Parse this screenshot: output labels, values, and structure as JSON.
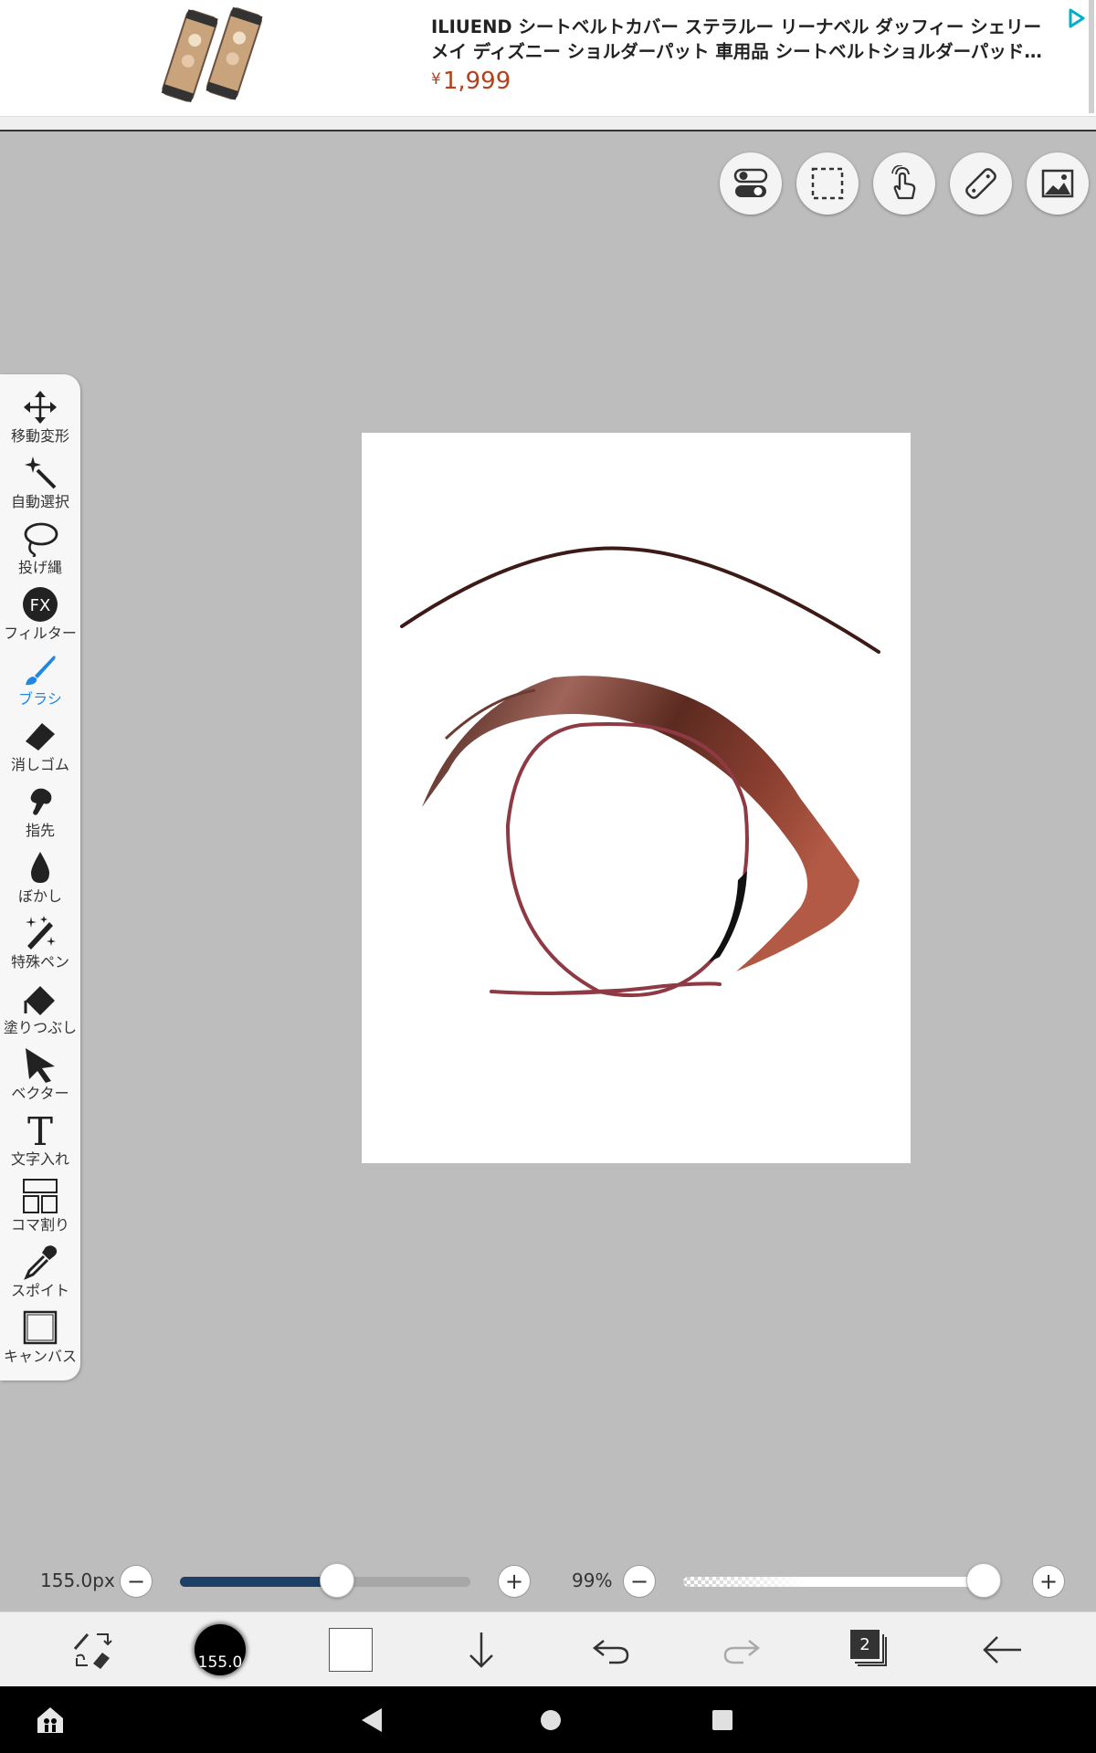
{
  "ad": {
    "title": "ILIUEND シートベルトカバー ステラルー リーナベル ダッフィー シェリーメイ ディズニー ショルダーパット 車用品 シートベルトショルダーパッド 肩...",
    "currency": "¥",
    "price": "1,999"
  },
  "top_buttons": [
    "toggle-icon",
    "selection-icon",
    "touch-hand-icon",
    "ruler-icon",
    "image-icon"
  ],
  "tools": [
    {
      "label": "移動変形",
      "icon": "move-transform-icon"
    },
    {
      "label": "自動選択",
      "icon": "magic-wand-icon"
    },
    {
      "label": "投げ縄",
      "icon": "lasso-icon"
    },
    {
      "label": "フィルター",
      "icon": "fx-filter-icon"
    },
    {
      "label": "ブラシ",
      "icon": "brush-icon",
      "active": true
    },
    {
      "label": "消しゴム",
      "icon": "eraser-icon"
    },
    {
      "label": "指先",
      "icon": "finger-smudge-icon"
    },
    {
      "label": "ぼかし",
      "icon": "blur-drop-icon"
    },
    {
      "label": "特殊ペン",
      "icon": "special-pen-icon"
    },
    {
      "label": "塗りつぶし",
      "icon": "fill-bucket-icon"
    },
    {
      "label": "ベクター",
      "icon": "vector-arrow-icon"
    },
    {
      "label": "文字入れ",
      "icon": "text-icon"
    },
    {
      "label": "コマ割り",
      "icon": "panel-split-icon"
    },
    {
      "label": "スポイト",
      "icon": "eyedropper-icon"
    },
    {
      "label": "キャンバス",
      "icon": "canvas-icon"
    }
  ],
  "brush_size": {
    "value_text": "155.0px",
    "fraction": 0.54,
    "minus": "−",
    "plus": "+"
  },
  "opacity": {
    "value_text": "99%",
    "fraction": 0.99,
    "minus": "−",
    "plus": "+"
  },
  "bottom_bar": {
    "brush_preview_text": "155.0",
    "layer_count": "2"
  },
  "colors": {
    "accent": "#1e88e5",
    "slider_fill": "#1e3f66",
    "ad_price": "#b3421b",
    "stroke_dark": "#5a2a22",
    "stroke_mid": "#8b3a3a",
    "stroke_light": "#b06b5b"
  }
}
